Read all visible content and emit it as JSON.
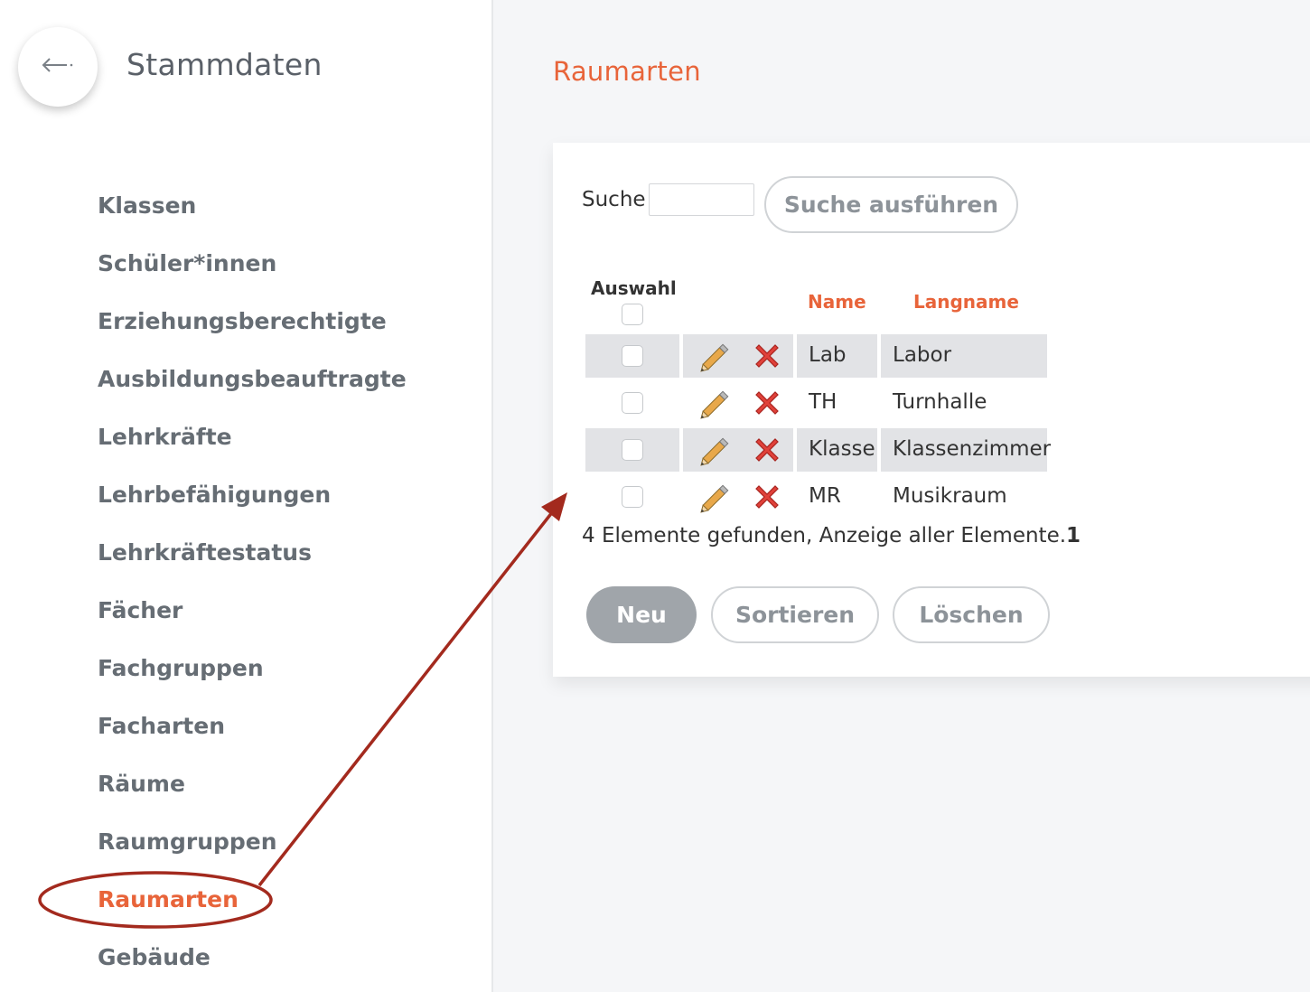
{
  "sidebar": {
    "title": "Stammdaten",
    "items": [
      {
        "label": "Klassen"
      },
      {
        "label": "Schüler*innen"
      },
      {
        "label": "Erziehungsberechtigte"
      },
      {
        "label": "Ausbildungsbeauftragte"
      },
      {
        "label": "Lehrkräfte"
      },
      {
        "label": "Lehrbefähigungen"
      },
      {
        "label": "Lehrkräftestatus"
      },
      {
        "label": "Fächer"
      },
      {
        "label": "Fachgruppen"
      },
      {
        "label": "Facharten"
      },
      {
        "label": "Räume"
      },
      {
        "label": "Raumgruppen"
      },
      {
        "label": "Raumarten"
      },
      {
        "label": "Gebäude"
      }
    ],
    "active_item": "Raumarten"
  },
  "main": {
    "title": "Raumarten",
    "search": {
      "label": "Suche",
      "value": "",
      "button_label": "Suche ausführen"
    },
    "table": {
      "headers": {
        "select": "Auswahl",
        "name": "Name",
        "longname": "Langname"
      },
      "rows": [
        {
          "name": "Lab",
          "longname": "Labor"
        },
        {
          "name": "TH",
          "longname": "Turnhalle"
        },
        {
          "name": "Klasse",
          "longname": "Klassenzimmer"
        },
        {
          "name": "MR",
          "longname": "Musikraum"
        }
      ]
    },
    "result": {
      "text": "4 Elemente gefunden, Anzeige aller Elemente.",
      "page": "1"
    },
    "buttons": {
      "new": "Neu",
      "sort": "Sortieren",
      "delete": "Löschen"
    }
  },
  "icons": {
    "back": "arrow-left-icon",
    "edit": "pencil-icon",
    "delete": "red-x-icon"
  },
  "colors": {
    "accent": "#e8643a",
    "annotation": "#a32a1e",
    "row_stripe": "#e2e3e6",
    "primary_button": "#a0a5aa"
  }
}
